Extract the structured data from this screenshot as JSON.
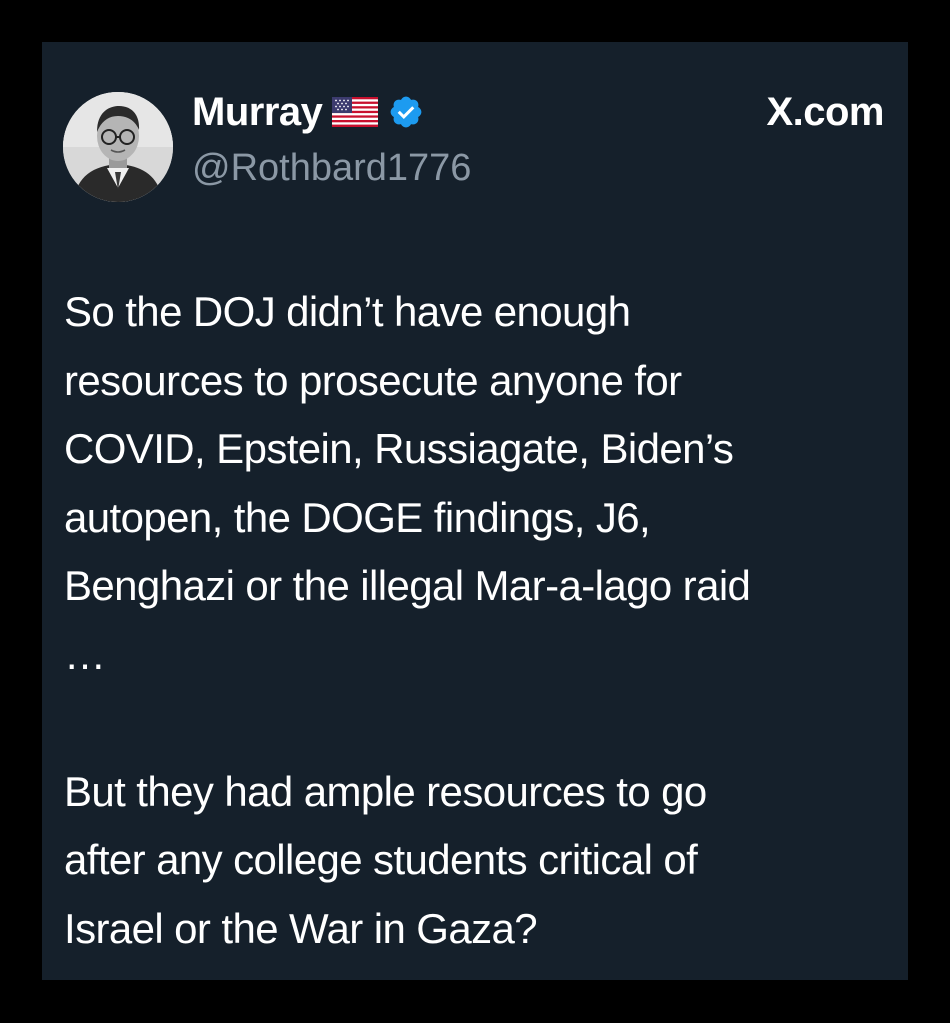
{
  "tweet": {
    "display_name": "Murray",
    "flag_icon": "us-flag-emoji",
    "verified_icon": "verified-badge",
    "verified_color": "#1d9bf0",
    "handle": "@Rothbard1776",
    "source": "X.com",
    "lines": [
      "So the DOJ didn’t have enough",
      "resources to prosecute anyone for",
      "COVID, Epstein, Russiagate, Biden’s",
      "autopen, the DOGE findings, J6,",
      "Benghazi or the illegal Mar-a-lago raid",
      "…",
      "",
      "But they had ample resources to go",
      "after any college students critical of",
      "Israel or the War in Gaza?"
    ]
  },
  "colors": {
    "frame": "#000000",
    "card_background": "#15202b",
    "text": "#ffffff",
    "secondary_text": "#8b98a5"
  }
}
